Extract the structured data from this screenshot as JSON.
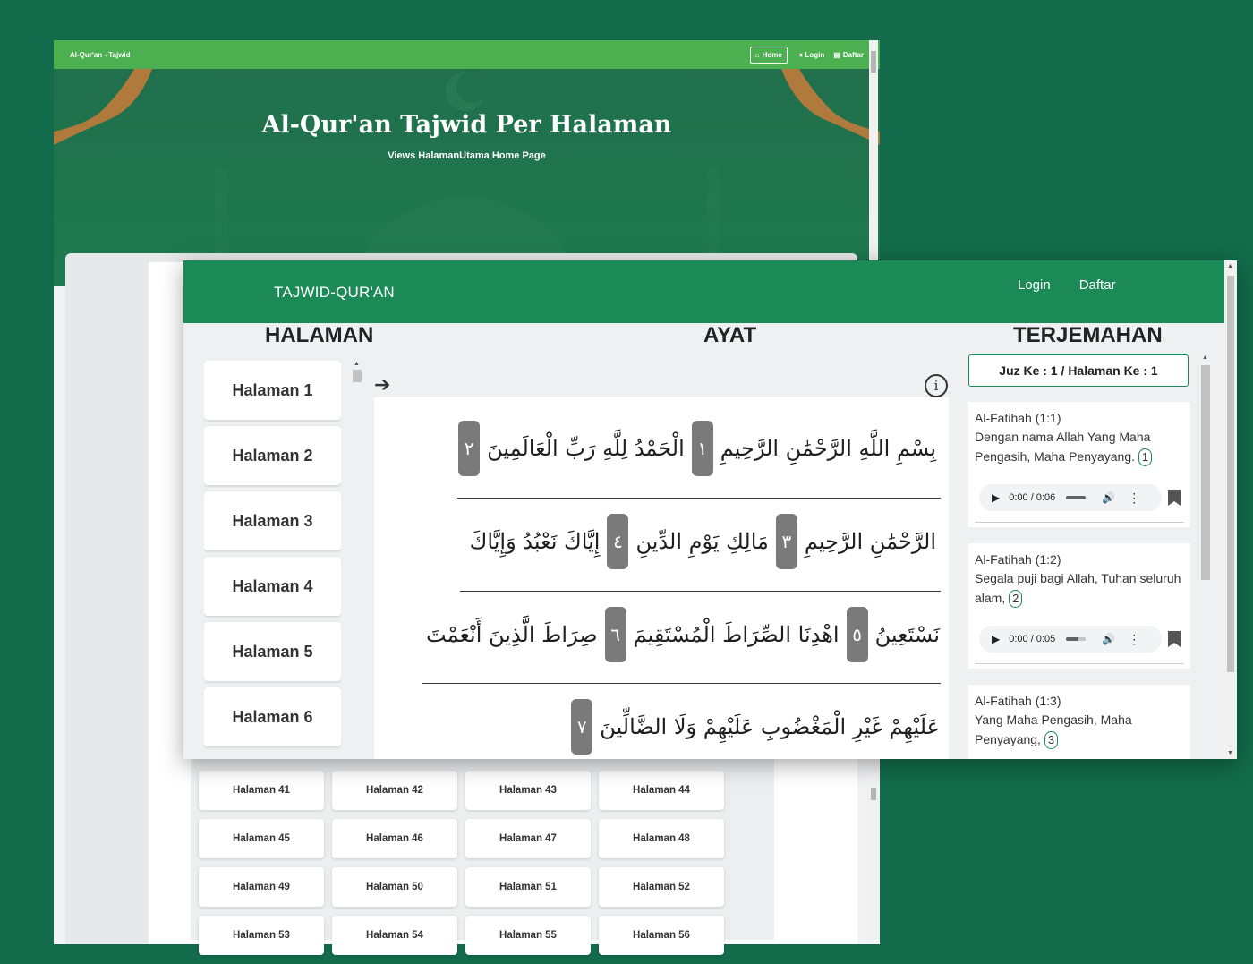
{
  "back_window": {
    "nav": {
      "brand": "Al-Qur'an - Tajwid",
      "links": [
        {
          "icon": "home-icon",
          "glyph": "⌂",
          "label": "Home"
        },
        {
          "icon": "login-icon",
          "glyph": "⇥",
          "label": "Login"
        },
        {
          "icon": "register-icon",
          "glyph": "▤",
          "label": "Daftar"
        }
      ]
    },
    "hero": {
      "title": "Al-Qur'an Tajwid Per Halaman",
      "subtitle": "Views HalamanUtama Home Page"
    },
    "grid_rows": [
      [
        "Halaman 41",
        "Halaman 42",
        "Halaman 43",
        "Halaman 44"
      ],
      [
        "Halaman 45",
        "Halaman 46",
        "Halaman 47",
        "Halaman 48"
      ],
      [
        "Halaman 49",
        "Halaman 50",
        "Halaman 51",
        "Halaman 52"
      ],
      [
        "Halaman 53",
        "Halaman 54",
        "Halaman 55",
        "Halaman 56"
      ]
    ]
  },
  "front_window": {
    "nav": {
      "brand": "TAJWID-QUR'AN",
      "login": "Login",
      "daftar": "Daftar"
    },
    "headers": {
      "halaman": "HALAMAN",
      "ayat": "AYAT",
      "terjemahan": "TERJEMAHAN"
    },
    "halaman_list": [
      "Halaman 1",
      "Halaman 2",
      "Halaman 3",
      "Halaman 4",
      "Halaman 5",
      "Halaman 6"
    ],
    "ayat_lines": [
      [
        {
          "type": "text",
          "value": "بِسْمِ اللَّهِ الرَّحْمَٰنِ الرَّحِيمِ"
        },
        {
          "type": "num",
          "value": "١"
        },
        {
          "type": "text",
          "value": "الْحَمْدُ لِلَّهِ رَبِّ الْعَالَمِينَ"
        },
        {
          "type": "num",
          "value": "٢"
        }
      ],
      [
        {
          "type": "text",
          "value": "الرَّحْمَٰنِ الرَّحِيمِ"
        },
        {
          "type": "num",
          "value": "٣"
        },
        {
          "type": "text",
          "value": "مَالِكِ يَوْمِ الدِّينِ"
        },
        {
          "type": "num",
          "value": "٤"
        },
        {
          "type": "text",
          "value": "إِيَّاكَ نَعْبُدُ وَإِيَّاكَ"
        }
      ],
      [
        {
          "type": "text",
          "value": "نَسْتَعِينُ"
        },
        {
          "type": "num",
          "value": "٥"
        },
        {
          "type": "text",
          "value": "اهْدِنَا الصِّرَاطَ الْمُسْتَقِيمَ"
        },
        {
          "type": "num",
          "value": "٦"
        },
        {
          "type": "text",
          "value": "صِرَاطَ الَّذِينَ أَنْعَمْتَ"
        }
      ],
      [
        {
          "type": "text",
          "value": "عَلَيْهِمْ غَيْرِ الْمَغْضُوبِ عَلَيْهِمْ وَلَا الضَّالِّينَ"
        },
        {
          "type": "num",
          "value": "٧"
        }
      ]
    ],
    "juz_label": "Juz Ke : 1 / Halaman Ke : 1",
    "translations": [
      {
        "surah": "Al-Fatihah (1:1)",
        "text": "Dengan nama Allah Yang Maha Pengasih, Maha Penyayang.",
        "num": "1",
        "audio_time": "0:00 / 0:06"
      },
      {
        "surah": "Al-Fatihah (1:2)",
        "text": "Segala puji bagi Allah, Tuhan seluruh alam,",
        "num": "2",
        "audio_time": "0:00 / 0:05"
      },
      {
        "surah": "Al-Fatihah (1:3)",
        "text": "Yang Maha Pengasih, Maha Penyayang,",
        "num": "3",
        "audio_time": ""
      }
    ]
  },
  "colors": {
    "background": "#126b4b",
    "front_nav": "#1c8a56",
    "back_nav": "#4caf50",
    "ayat_number_badge": "#7a7a7a"
  }
}
